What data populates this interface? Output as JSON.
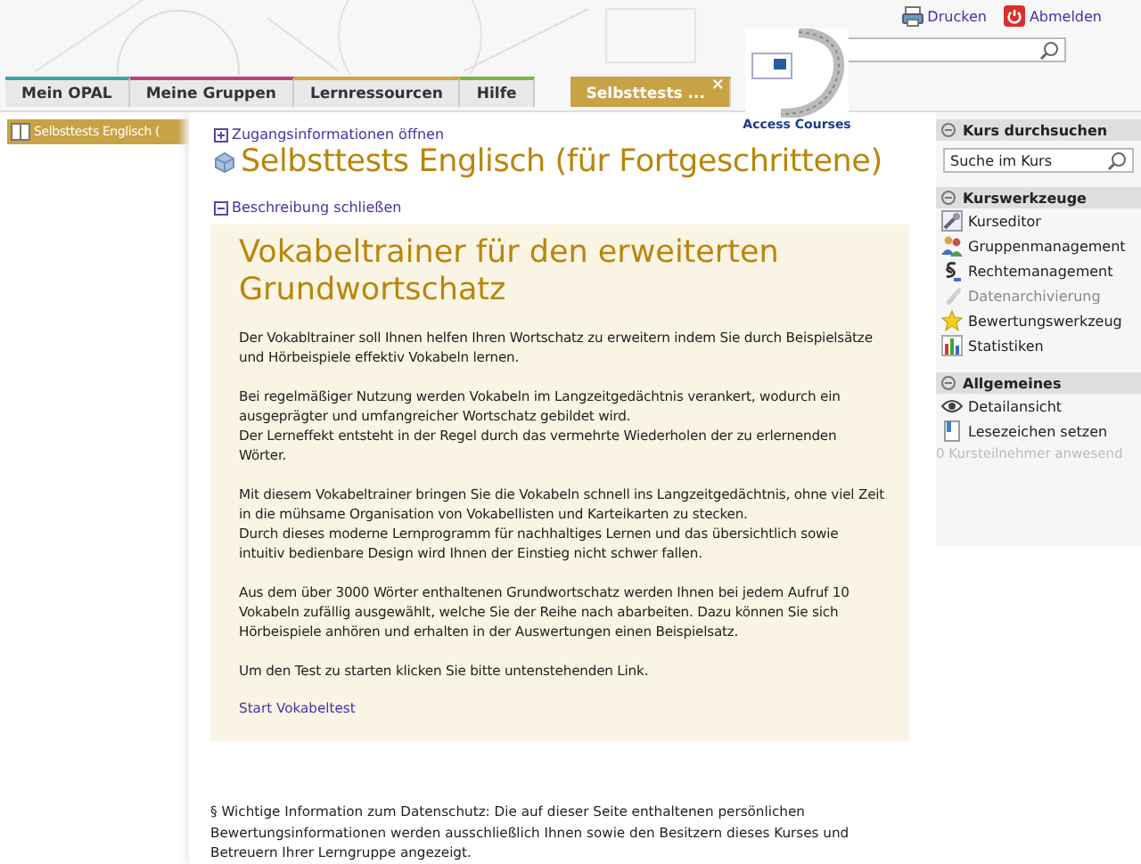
{
  "header": {
    "links": [
      {
        "label": "Drucken",
        "kind": "print"
      },
      {
        "label": "Abmelden",
        "kind": "logout"
      }
    ],
    "logo_caption": "Access Courses"
  },
  "tabs": [
    {
      "label": "Mein OPAL",
      "selected": false,
      "color": "#3aa6a6"
    },
    {
      "label": "Meine Gruppen",
      "selected": false,
      "color": "#c0407a"
    },
    {
      "label": "Lernressourcen",
      "selected": false,
      "color": "#d4a33a"
    },
    {
      "label": "Hilfe",
      "selected": false,
      "color": "#7ab83a"
    },
    {
      "label": "Selbsttests ...",
      "selected": true,
      "close": "×",
      "color": "#c9a246"
    }
  ],
  "left_nav": {
    "items": [
      {
        "label": "Selbsttests Englisch (",
        "selected": true
      }
    ]
  },
  "main": {
    "access_toggle": "Zugangsinformationen öffnen",
    "title": "Selbsttests Englisch (für Fortgeschrittene)",
    "description_toggle": "Beschreibung schließen",
    "description": {
      "heading": "Vokabeltrainer für den erweiterten Grundwortschatz",
      "paragraphs": [
        [
          "Der Vokabltrainer soll Ihnen helfen Ihren Wortschatz zu erweitern indem Sie durch Beispielsätze und Hörbeispiele effektiv Vokabeln lernen."
        ],
        [
          "Bei regelmäßiger Nutzung werden Vokabeln im Langzeitgedächtnis verankert, wodurch ein ausgeprägter und umfangreicher Wortschatz gebildet wird.",
          "Der Lerneffekt entsteht in der Regel durch das vermehrte Wiederholen der zu erlernenden Wörter."
        ],
        [
          "Mit diesem Vokabeltrainer bringen Sie die Vokabeln schnell ins Langzeitgedächtnis, ohne viel Zeit in die mühsame Organisation von Vokabellisten und Karteikarten zu stecken.",
          "Durch dieses moderne Lernprogramm für nachhaltiges Lernen und das übersichtlich sowie intuitiv bedienbare Design wird Ihnen der Einstieg nicht schwer fallen."
        ],
        [
          "Aus dem über 3000 Wörter enthaltenen Grundwortschatz werden Ihnen bei jedem Aufruf 10 Vokabeln zufällig ausgewählt, welche Sie der Reihe nach abarbeiten. Dazu können Sie sich Hörbeispiele anhören und erhalten in der Auswertungen einen Beispielsatz."
        ],
        [
          "Um den Test zu starten klicken Sie bitte untenstehenden Link."
        ]
      ],
      "link": "Start Vokabeltest"
    },
    "privacy_note": "§ Wichtige Information zum Datenschutz: Die auf dieser Seite enthaltenen persönlichen Bewertungsinformationen werden ausschließlich Ihnen sowie den Besitzern dieses Kurses und Betreuern Ihrer Lerngruppe angezeigt."
  },
  "right_sidebar": {
    "sections": [
      {
        "title": "Kurs durchsuchen",
        "search": {
          "value": "Suche im Kurs"
        }
      },
      {
        "title": "Kurswerkzeuge",
        "items": [
          {
            "label": "Kurseditor",
            "kind": "wrench",
            "disabled": false
          },
          {
            "label": "Gruppenmanagement",
            "kind": "people",
            "disabled": false
          },
          {
            "label": "Rechtemanagement",
            "kind": "paragraph",
            "disabled": false
          },
          {
            "label": "Datenarchivierung",
            "kind": "clip",
            "disabled": true
          },
          {
            "label": "Bewertungswerkzeug",
            "kind": "star",
            "disabled": false
          },
          {
            "label": "Statistiken",
            "kind": "chart",
            "disabled": false
          }
        ]
      },
      {
        "title": "Allgemeines",
        "items": [
          {
            "label": "Detailansicht",
            "kind": "eye",
            "disabled": false
          },
          {
            "label": "Lesezeichen setzen",
            "kind": "bookmark",
            "disabled": false
          }
        ],
        "footer": "0 Kursteilnehmer anwesend"
      }
    ]
  }
}
